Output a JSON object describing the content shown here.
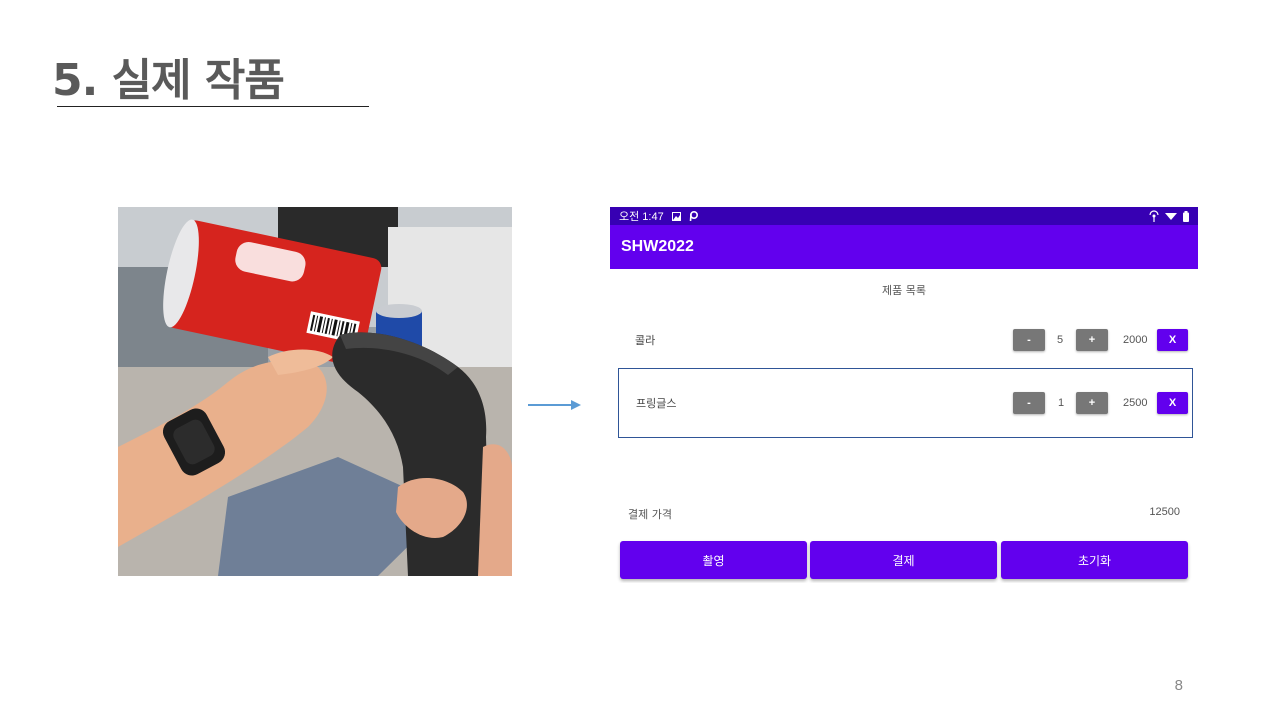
{
  "slide": {
    "title": "5. 실제 작품",
    "page_number": "8"
  },
  "status_bar": {
    "time": "오전 1:47",
    "left_icons": [
      "gallery-icon",
      "p-app-icon"
    ],
    "right_icons": [
      "hotspot-icon",
      "wifi-icon",
      "battery-icon"
    ]
  },
  "app": {
    "title": "SHW2022",
    "list_title": "제품 목록",
    "items": [
      {
        "name": "콜라",
        "minus": "-",
        "qty": "5",
        "plus": "+",
        "price": "2000",
        "remove": "X",
        "selected": false
      },
      {
        "name": "프링글스",
        "minus": "-",
        "qty": "1",
        "plus": "+",
        "price": "2500",
        "remove": "X",
        "selected": true
      }
    ],
    "total_label": "결제 가격",
    "total_value": "12500",
    "buttons": {
      "capture": "촬영",
      "pay": "결제",
      "reset": "초기화"
    }
  },
  "colors": {
    "status_bar": "#3700b3",
    "app_bar": "#6200ee",
    "button_primary": "#6200ee",
    "button_secondary": "#777777",
    "selection_border": "#2f5597",
    "arrow": "#5b9bd5"
  }
}
